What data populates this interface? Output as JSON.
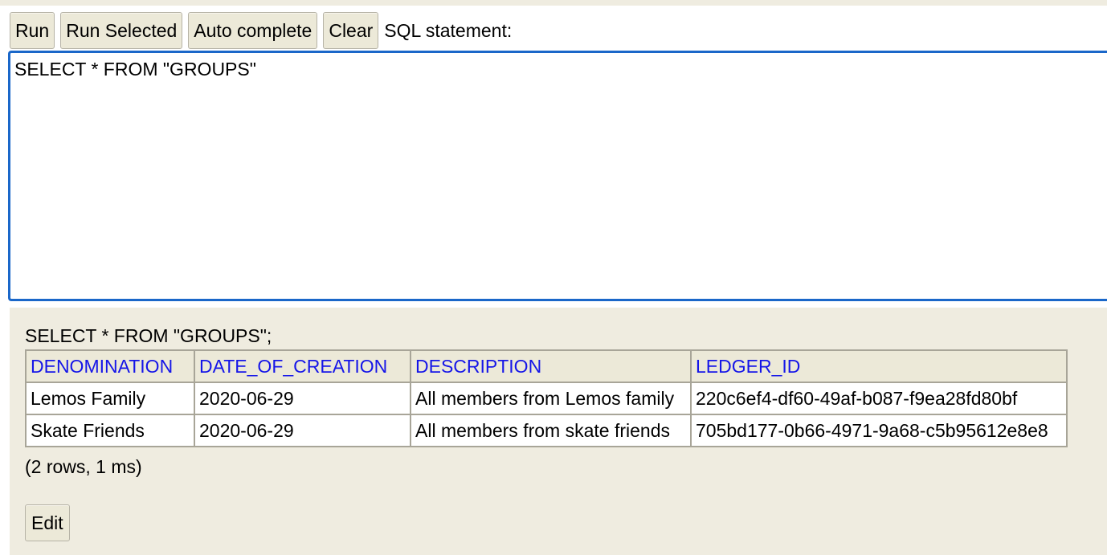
{
  "toolbar": {
    "run_label": "Run",
    "run_selected_label": "Run Selected",
    "auto_complete_label": "Auto complete",
    "clear_label": "Clear",
    "sql_statement_label": "SQL statement:"
  },
  "editor": {
    "value": "SELECT * FROM \"GROUPS\""
  },
  "results": {
    "query": "SELECT * FROM \"GROUPS\";",
    "columns": [
      "DENOMINATION",
      "DATE_OF_CREATION",
      "DESCRIPTION",
      "LEDGER_ID"
    ],
    "rows": [
      [
        "Lemos Family",
        "2020-06-29",
        "All members from Lemos family",
        "220c6ef4-df60-49af-b087-f9ea28fd80bf"
      ],
      [
        "Skate Friends",
        "2020-06-29",
        "All members from skate friends",
        "705bd177-0b66-4971-9a68-c5b95612e8e8"
      ]
    ],
    "row_count_text": "(2 rows, 1 ms)",
    "edit_label": "Edit"
  },
  "colors": {
    "panel_background": "#efece0",
    "button_background": "#ece9d8",
    "editor_border": "#1a67c9",
    "header_link": "#1515e8"
  }
}
